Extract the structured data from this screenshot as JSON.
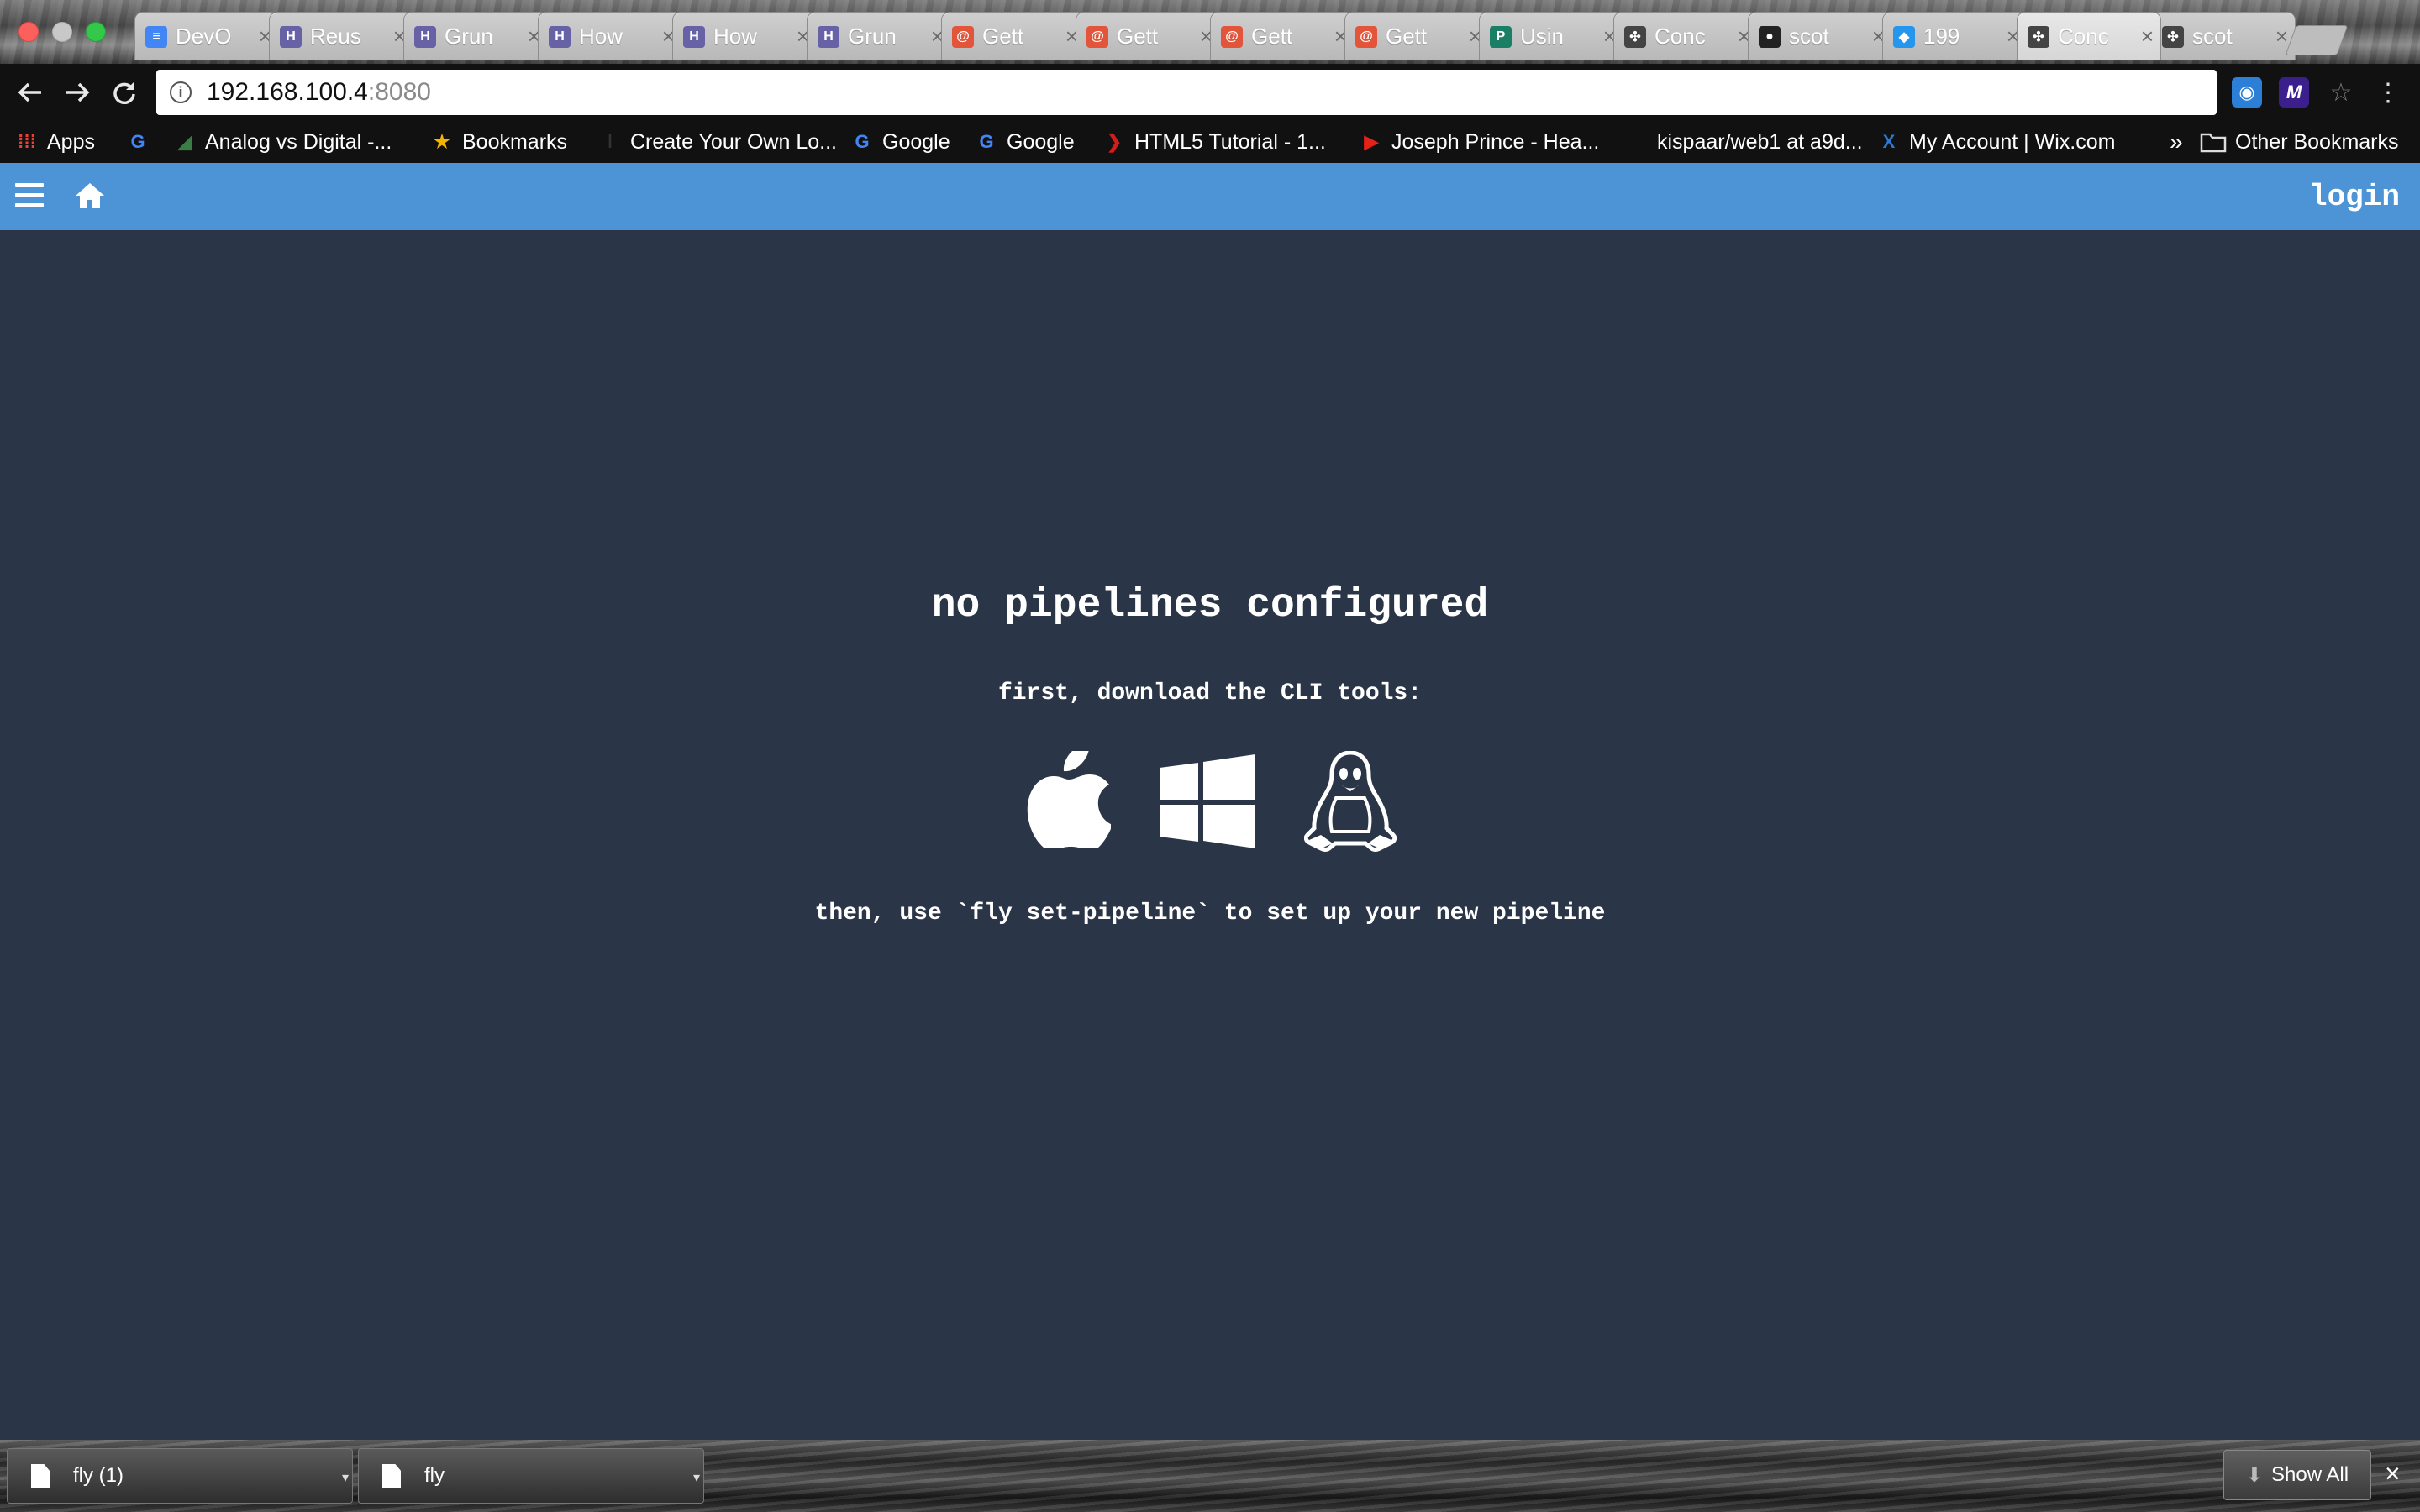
{
  "browser": {
    "tabs": [
      {
        "title": "DevO",
        "icon": "google-docs-icon",
        "color": "#4285f4",
        "glyph": "≡"
      },
      {
        "title": "Reus",
        "icon": "heroku-icon",
        "color": "#6762a6",
        "glyph": "H"
      },
      {
        "title": "Grun",
        "icon": "heroku-icon",
        "color": "#6762a6",
        "glyph": "H"
      },
      {
        "title": "How",
        "icon": "heroku-icon",
        "color": "#6762a6",
        "glyph": "H"
      },
      {
        "title": "How",
        "icon": "heroku-icon",
        "color": "#6762a6",
        "glyph": "H"
      },
      {
        "title": "Grun",
        "icon": "heroku-icon",
        "color": "#6762a6",
        "glyph": "H"
      },
      {
        "title": "Gett",
        "icon": "swirl-icon",
        "color": "#e2553b",
        "glyph": "@"
      },
      {
        "title": "Gett",
        "icon": "swirl-icon",
        "color": "#e2553b",
        "glyph": "@"
      },
      {
        "title": "Gett",
        "icon": "swirl-icon",
        "color": "#e2553b",
        "glyph": "@"
      },
      {
        "title": "Gett",
        "icon": "swirl-icon",
        "color": "#e2553b",
        "glyph": "@"
      },
      {
        "title": "Usin",
        "icon": "p-icon",
        "color": "#1a7f64",
        "glyph": "P"
      },
      {
        "title": "Conc",
        "icon": "concourse-icon",
        "color": "#444444",
        "glyph": "✣"
      },
      {
        "title": "scot",
        "icon": "github-icon",
        "color": "#222222",
        "glyph": "●"
      },
      {
        "title": "199",
        "icon": "docker-icon",
        "color": "#2496ed",
        "glyph": "◆"
      },
      {
        "title": "Conc",
        "icon": "concourse-icon",
        "color": "#444444",
        "glyph": "✣",
        "active": true
      },
      {
        "title": "scot",
        "icon": "concourse-icon",
        "color": "#444444",
        "glyph": "✣"
      }
    ],
    "address": {
      "host": "192.168.100.4",
      "port": ":8080"
    },
    "bookmarks": [
      {
        "label": "Apps",
        "icon": "apps-grid-icon",
        "color": "#e94235",
        "glyph": "⁞⁞⁞"
      },
      {
        "label": "",
        "icon": "google-icon",
        "color": "#4285f4",
        "glyph": "G"
      },
      {
        "label": "Analog vs Digital -...",
        "icon": "analog-icon",
        "color": "#3a7d44",
        "glyph": "◢"
      },
      {
        "label": "Bookmarks",
        "icon": "star-icon",
        "color": "#f5b400",
        "glyph": "★"
      },
      {
        "label": "Create Your Own Lo...",
        "icon": "zipper-icon",
        "color": "#333333",
        "glyph": "ǀ"
      },
      {
        "label": "Google",
        "icon": "google-icon",
        "color": "#4285f4",
        "glyph": "G"
      },
      {
        "label": "Google",
        "icon": "google-icon",
        "color": "#4285f4",
        "glyph": "G"
      },
      {
        "label": "HTML5 Tutorial - 1...",
        "icon": "html5-icon",
        "color": "#d31c1c",
        "glyph": "❯"
      },
      {
        "label": "Joseph Prince - Hea...",
        "icon": "youtube-icon",
        "color": "#e62117",
        "glyph": "▶"
      },
      {
        "label": "kispaar/web1 at a9d...",
        "icon": "github-icon",
        "color": "#111111",
        "glyph": "●"
      },
      {
        "label": "My Account | Wix.com",
        "icon": "wix-icon",
        "color": "#2a7ad4",
        "glyph": "X"
      }
    ],
    "bookmarks_overflow": "»",
    "other_bookmarks": "Other Bookmarks"
  },
  "app": {
    "login_label": "login",
    "headline": "no pipelines configured",
    "download_prompt": "first, download the CLI tools:",
    "cli_icons": [
      "apple-icon",
      "windows-icon",
      "linux-tux-icon"
    ],
    "instruction": "then, use `fly set-pipeline` to set up your new pipeline"
  },
  "downloads": {
    "items": [
      {
        "name": "fly (1)"
      },
      {
        "name": "fly"
      }
    ],
    "show_all_label": "Show All"
  }
}
